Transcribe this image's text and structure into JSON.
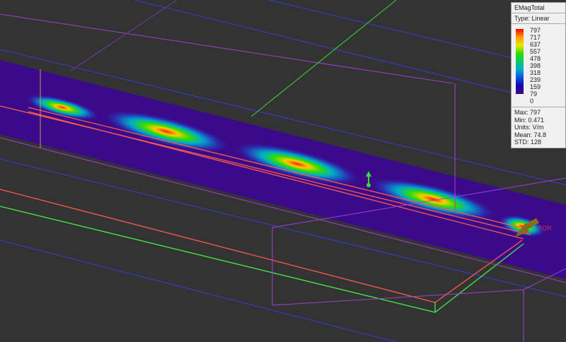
{
  "legend": {
    "title": "EMagTotal",
    "type": "Type: Linear",
    "ticks": [
      "797",
      "717",
      "637",
      "557",
      "478",
      "398",
      "318",
      "239",
      "159",
      "79",
      "0"
    ],
    "stats": {
      "max": "Max: 797",
      "min": "Min: 0.471",
      "units": "Units: V/m",
      "mean": "Mean: 74.8",
      "std": "STD: 128"
    }
  },
  "port_label": "POR",
  "colors": {
    "background": "#333333",
    "field_low": "#3a0a8a",
    "field_high": "#ff2000",
    "edge_red": "#ff5a4a",
    "edge_green": "#44ee44",
    "edge_blue": "#3a3ae0",
    "edge_purple": "#a040d0"
  }
}
